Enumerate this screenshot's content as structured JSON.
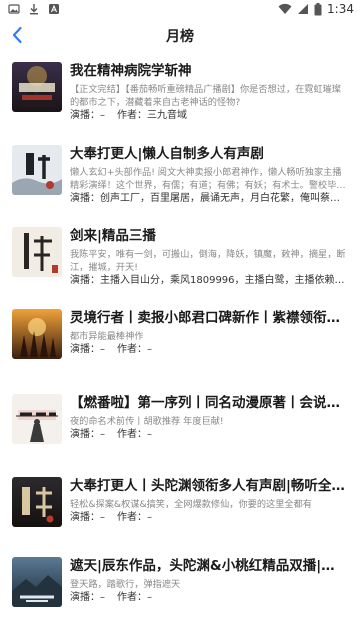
{
  "status_bar": {
    "time": "1:34",
    "left_icons": [
      "gallery-icon",
      "download-icon",
      "font-icon"
    ],
    "right_icons": [
      "wifi-icon",
      "signal-icon",
      "battery-icon"
    ]
  },
  "nav": {
    "title": "月榜",
    "back_icon": "chevron-left-icon"
  },
  "labels": {
    "performer": "演播：",
    "author": "作者："
  },
  "items": [
    {
      "title": "我在精神病院学斩神",
      "desc": "【正文完结】【番茄畅听重磅精品广播剧】你是否想过，在霓虹璀璨的都市之下，潜藏着来自古老神话的怪物?",
      "performer": "–",
      "author": "三九音域"
    },
    {
      "title": "大奉打更人|懒人自制多人有声剧",
      "desc": "懒人玄幻+头部作品!  阅文大神卖报小郎君神作，懒人畅听独家主播精彩演绎！这个世界，有儒；有道；有佛；有妖；有术士。警校毕…",
      "performer": "创声工厂，百里屠居，晨诵无声，月白花繁，俺叫蔡…",
      "author": ""
    },
    {
      "title": "剑来|精品三播",
      "desc": "我陈平安，唯有一剑，可搬山，倒海，降妖，镇魔，敕神，摘星，断江，摧城，开天!",
      "performer": "主播入目山分，乘风1809996，主播白鹭，主播依赖…",
      "author": ""
    },
    {
      "title": "灵境行者丨卖报小郎君口碑新作丨紫襟领衔…",
      "desc": "都市异能最棒神作",
      "performer": "–",
      "author": "–"
    },
    {
      "title": "【燃番啦】第一序列丨同名动漫原著丨会说话…",
      "desc": "夜的命名术前传丨胡歌推荐 年度巨献!",
      "performer": "–",
      "author": "–"
    },
    {
      "title": "大奉打更人丨头陀渊领衔多人有声剧|畅听全…",
      "desc": "轻松&探案&权谋&搞笑，全网爆款修仙，你要的这里全都有",
      "performer": "–",
      "author": "–"
    },
    {
      "title": "遮天|辰东作品，头陀渊&小桃红精品双播|热…",
      "desc": "登天路，踏歌行，弹指遮天",
      "performer": "–",
      "author": "–"
    }
  ]
}
